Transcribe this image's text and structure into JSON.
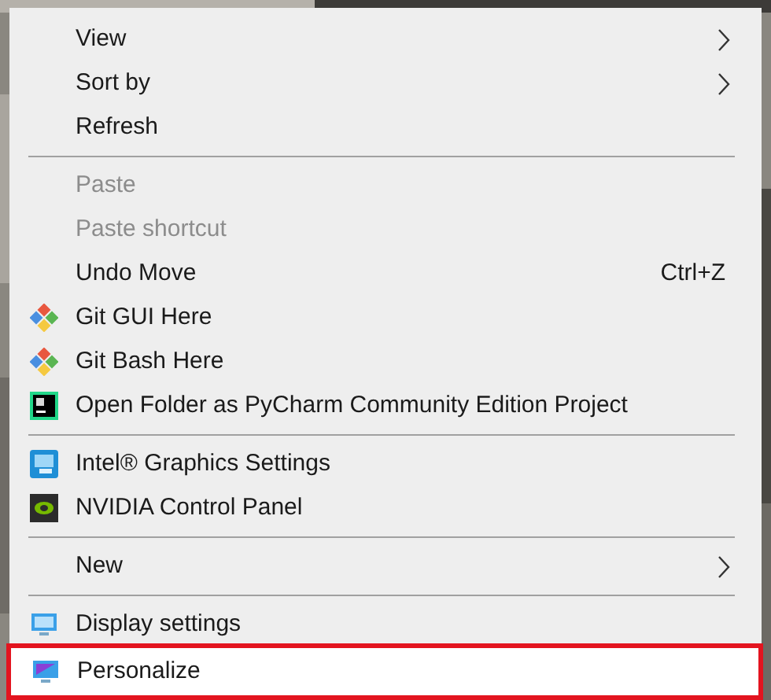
{
  "menu": {
    "items": [
      {
        "kind": "item",
        "label": "View",
        "submenu": true,
        "disabled": false,
        "selected": false
      },
      {
        "kind": "item",
        "label": "Sort by",
        "submenu": true,
        "disabled": false,
        "selected": false
      },
      {
        "kind": "item",
        "label": "Refresh",
        "disabled": false,
        "selected": false
      },
      {
        "kind": "separator"
      },
      {
        "kind": "item",
        "label": "Paste",
        "disabled": true,
        "selected": false
      },
      {
        "kind": "item",
        "label": "Paste shortcut",
        "disabled": true,
        "selected": false
      },
      {
        "kind": "item",
        "label": "Undo Move",
        "shortcut": "Ctrl+Z",
        "disabled": false,
        "selected": false
      },
      {
        "kind": "item",
        "label": "Git GUI Here",
        "disabled": false,
        "selected": false
      },
      {
        "kind": "item",
        "label": "Git Bash Here",
        "disabled": false,
        "selected": false
      },
      {
        "kind": "item",
        "label": "Open Folder as PyCharm Community Edition Project",
        "disabled": false,
        "selected": false
      },
      {
        "kind": "separator"
      },
      {
        "kind": "item",
        "label": "Intel® Graphics Settings",
        "disabled": false,
        "selected": false
      },
      {
        "kind": "item",
        "label": "NVIDIA Control Panel",
        "disabled": false,
        "selected": false
      },
      {
        "kind": "separator"
      },
      {
        "kind": "item",
        "label": "New",
        "submenu": true,
        "disabled": false,
        "selected": false
      },
      {
        "kind": "separator"
      },
      {
        "kind": "item",
        "label": "Display settings",
        "disabled": false,
        "selected": false
      },
      {
        "kind": "item",
        "label": "Personalize",
        "disabled": false,
        "selected": true
      }
    ]
  }
}
